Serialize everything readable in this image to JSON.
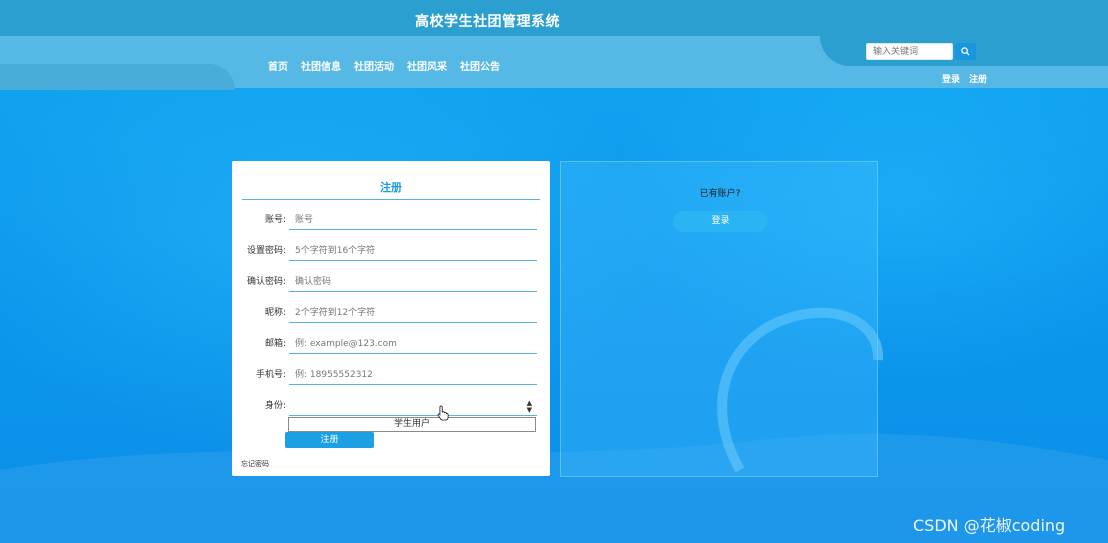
{
  "header": {
    "site_title": "高校学生社团管理系统",
    "nav": [
      "首页",
      "社团信息",
      "社团活动",
      "社团风采",
      "社团公告"
    ],
    "search_placeholder": "输入关键词",
    "login_link": "登录",
    "register_link": "注册"
  },
  "register_form": {
    "title": "注册",
    "fields": [
      {
        "label": "账号:",
        "placeholder": "账号"
      },
      {
        "label": "设置密码:",
        "placeholder": "5个字符到16个字符"
      },
      {
        "label": "确认密码:",
        "placeholder": "确认密码"
      },
      {
        "label": "昵称:",
        "placeholder": "2个字符到12个字符"
      },
      {
        "label": "邮箱:",
        "placeholder": "例: example@123.com"
      },
      {
        "label": "手机号:",
        "placeholder": "例: 18955552312"
      }
    ],
    "identity_label": "身份:",
    "identity_option": "学生用户",
    "submit_label": "注册",
    "forgot_label": "忘记密码"
  },
  "login_panel": {
    "prompt": "已有账户?",
    "login_label": "登录"
  },
  "watermark": "CSDN @花椒coding",
  "colors": {
    "accent": "#1ba0e6",
    "header_dark": "#2a9fd0",
    "header_light": "#56b8e4",
    "field_underline": "#57b2df"
  }
}
